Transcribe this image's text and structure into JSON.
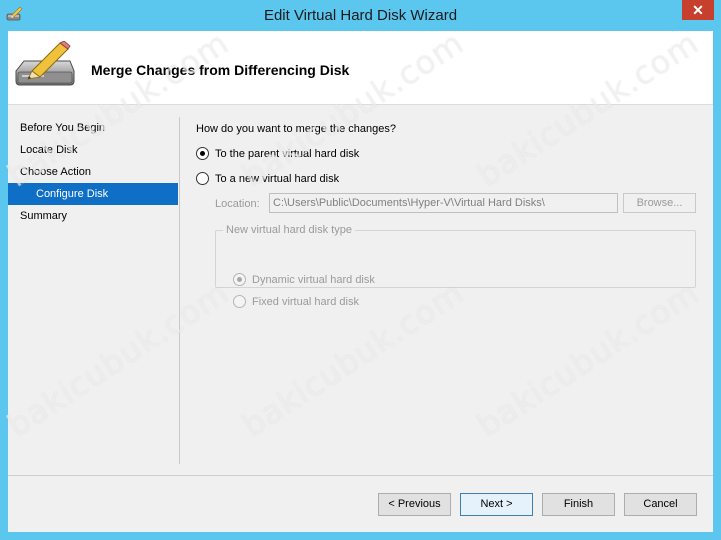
{
  "window": {
    "title": "Edit Virtual Hard Disk Wizard",
    "close_label": "✕"
  },
  "header": {
    "title": "Merge Changes from Differencing Disk",
    "icon": "disk-pencil-icon"
  },
  "nav": {
    "items": [
      {
        "label": "Before You Begin"
      },
      {
        "label": "Locate Disk"
      },
      {
        "label": "Choose Action"
      },
      {
        "label": "Configure Disk",
        "active": true
      },
      {
        "label": "Summary"
      }
    ]
  },
  "main": {
    "question": "How do you want to merge the changes?",
    "option_parent": "To the parent virtual hard disk",
    "option_new": "To a new virtual hard disk",
    "location_label": "Location:",
    "location_value": "C:\\Users\\Public\\Documents\\Hyper-V\\Virtual Hard Disks\\",
    "browse_label": "Browse...",
    "disk_type_legend": "New virtual hard disk type",
    "disk_type_dynamic": "Dynamic virtual hard disk",
    "disk_type_fixed": "Fixed virtual hard disk"
  },
  "footer": {
    "previous_label": "< Previous",
    "next_label": "Next >",
    "finish_label": "Finish",
    "cancel_label": "Cancel"
  },
  "watermark": {
    "text": "bakicubuk.com"
  },
  "colors": {
    "titlebar": "#5bc7ef",
    "close": "#c7402e",
    "nav_active": "#0f6fc6"
  }
}
